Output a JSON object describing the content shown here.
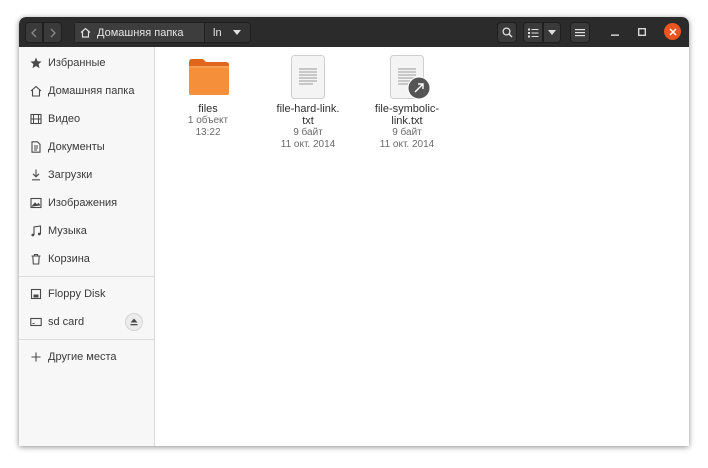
{
  "toolbar": {
    "back_icon": "chevron-left-icon",
    "forward_icon": "chevron-right-icon",
    "path": [
      {
        "label": "Домашняя папка",
        "icon": "home-icon"
      },
      {
        "label": "ln"
      }
    ],
    "search_icon": "search-icon",
    "view_icon": "list-view-icon",
    "menu_icon": "hamburger-icon",
    "accent_close": "#e95420"
  },
  "sidebar": {
    "items": [
      {
        "label": "Избранные",
        "icon": "star-icon"
      },
      {
        "label": "Домашняя папка",
        "icon": "home-icon"
      },
      {
        "label": "Видео",
        "icon": "film-icon"
      },
      {
        "label": "Документы",
        "icon": "document-icon"
      },
      {
        "label": "Загрузки",
        "icon": "download-icon"
      },
      {
        "label": "Изображения",
        "icon": "image-icon"
      },
      {
        "label": "Музыка",
        "icon": "music-icon"
      },
      {
        "label": "Корзина",
        "icon": "trash-icon"
      }
    ],
    "devices": [
      {
        "label": "Floppy Disk",
        "icon": "drive-icon"
      },
      {
        "label": "sd card",
        "icon": "drive-icon",
        "eject_icon": "eject-icon"
      }
    ],
    "other": {
      "label": "Другие места",
      "icon": "plus-icon"
    }
  },
  "files": [
    {
      "name": "files",
      "line2": "1 объект",
      "line3": "13:22",
      "icon": "folder-icon"
    },
    {
      "name": "file-hard-link.",
      "name2": "txt",
      "line2": "9 байт",
      "line3": "11 окт. 2014",
      "icon": "text-file-icon"
    },
    {
      "name": "file-symbolic-",
      "name2": "link.txt",
      "line2": "9 байт",
      "line3": "11 окт. 2014",
      "icon": "text-file-symlink-icon"
    }
  ]
}
